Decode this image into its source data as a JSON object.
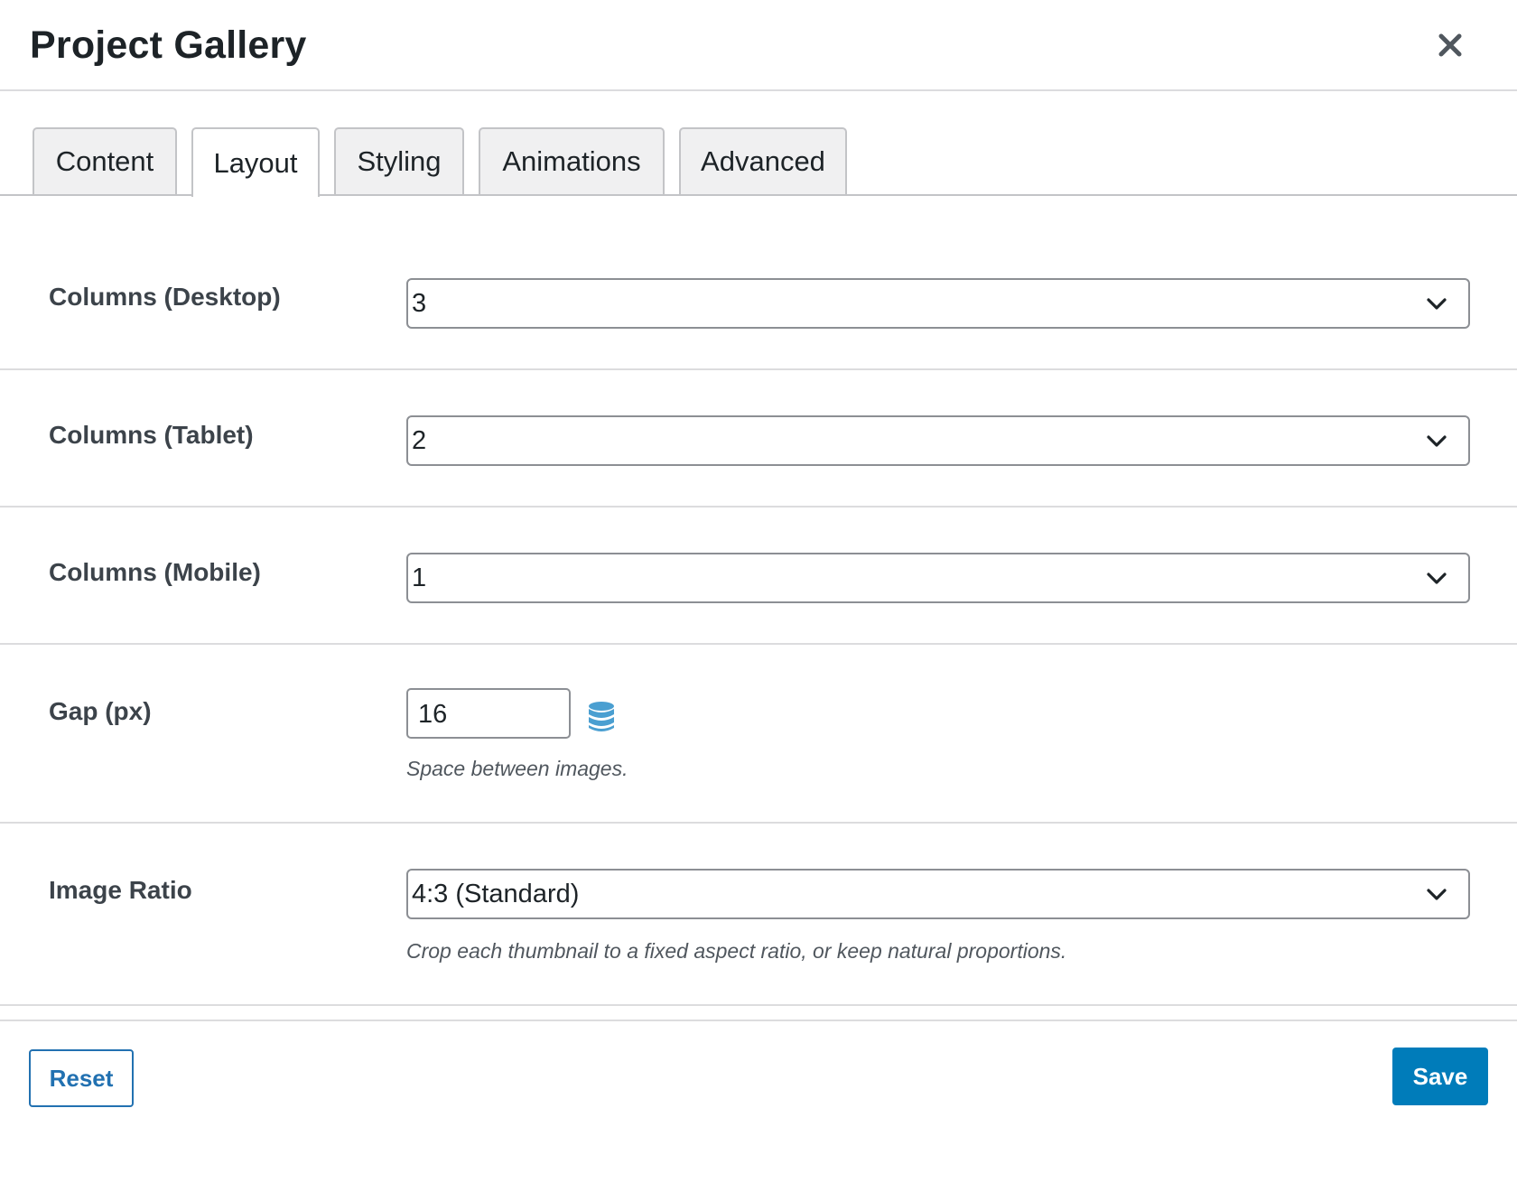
{
  "dialog": {
    "title": "Project Gallery",
    "close_icon": "close-icon"
  },
  "tabs": [
    {
      "label": "Content",
      "active": false
    },
    {
      "label": "Layout",
      "active": true
    },
    {
      "label": "Styling",
      "active": false
    },
    {
      "label": "Animations",
      "active": false
    },
    {
      "label": "Advanced",
      "active": false
    }
  ],
  "fields": {
    "columns_desktop": {
      "label": "Columns (Desktop)",
      "value": "3"
    },
    "columns_tablet": {
      "label": "Columns (Tablet)",
      "value": "2"
    },
    "columns_mobile": {
      "label": "Columns (Mobile)",
      "value": "1"
    },
    "gap": {
      "label": "Gap (px)",
      "value": "16",
      "help": "Space between images.",
      "icon": "database-icon"
    },
    "image_ratio": {
      "label": "Image Ratio",
      "value": "4:3 (Standard)",
      "help": "Crop each thumbnail to a fixed aspect ratio, or keep natural proportions."
    }
  },
  "footer": {
    "reset_label": "Reset",
    "save_label": "Save"
  },
  "colors": {
    "accent": "#007cba",
    "accent_link": "#2271b1",
    "icon_blue": "#4a9fd1"
  }
}
